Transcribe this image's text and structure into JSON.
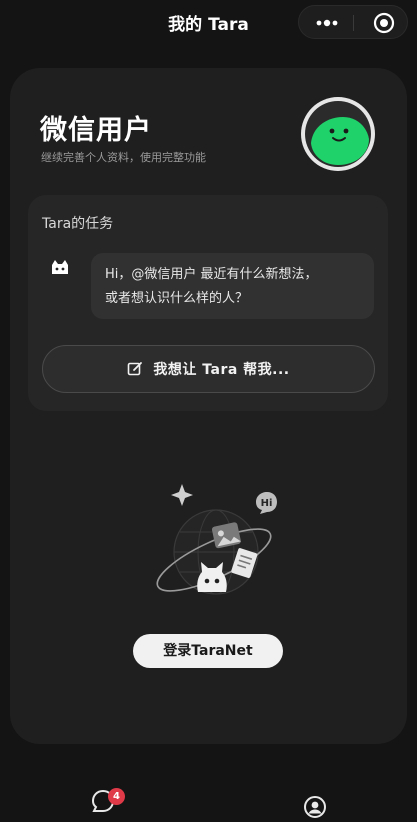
{
  "nav": {
    "title": "我的 Tara",
    "icons": [
      "more-dots-icon",
      "target-icon"
    ]
  },
  "profile": {
    "name": "微信用户",
    "subtitle": "继续完善个人资料，使用完整功能",
    "avatar_icon": "green-smiley-avatar"
  },
  "task": {
    "title": "Tara的任务",
    "message_line1": "Hi，@微信用户 最近有什么新想法，",
    "message_line2": "或者想认识什么样的人？",
    "button_label": "我想让 Tara 帮我...",
    "button_icon": "edit-icon"
  },
  "illustration": {
    "bubble_text": "Hi"
  },
  "login": {
    "button_label": "登录TaraNet"
  },
  "tabbar": {
    "chat_badge": "4",
    "icons": [
      "chat-icon",
      "profile-icon"
    ]
  },
  "colors": {
    "background": "#141414",
    "card": "#1f1f1f",
    "avatar_green": "#1fd26a",
    "badge_red": "#e03a48"
  }
}
